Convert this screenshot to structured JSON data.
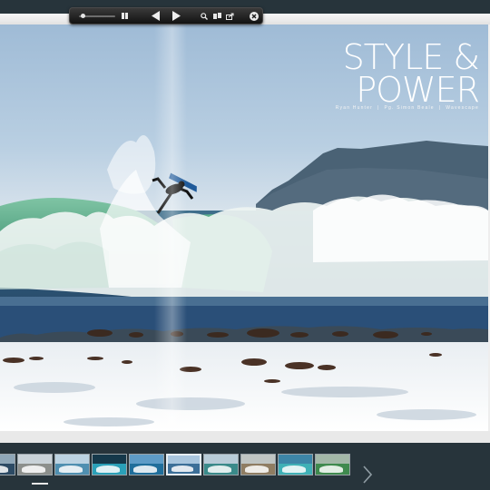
{
  "article": {
    "headline_line1": "STYLE &",
    "headline_line2": "POWER",
    "credit_rider": "Ryan Hunter",
    "credit_photo": "Pg. Simon Beale",
    "credit_publication": "Wavescape"
  },
  "toolbar": {
    "zoom_level": 0.05,
    "icons": [
      "zoom-slider",
      "view-mode-icon",
      "previous-page-icon",
      "next-page-icon",
      "search-icon",
      "pages-icon",
      "share-icon",
      "close-icon"
    ]
  },
  "thumbnails": {
    "active_index": 5,
    "items": [
      {
        "label": "thumb-1",
        "sky": "#8fa7b8",
        "sea": "#2c4a64"
      },
      {
        "label": "thumb-2",
        "sky": "#c9d2d8",
        "sea": "#8c8f8c"
      },
      {
        "label": "thumb-3",
        "sky": "#bcd3e2",
        "sea": "#4f8fb0"
      },
      {
        "label": "thumb-4",
        "sky": "#15384a",
        "sea": "#2aa0b8"
      },
      {
        "label": "thumb-5",
        "sky": "#5e9cc7",
        "sea": "#1f6e9b"
      },
      {
        "label": "thumb-6",
        "sky": "#a9c6de",
        "sea": "#3c6f98"
      },
      {
        "label": "thumb-7",
        "sky": "#b8ccd8",
        "sea": "#3a8a8a"
      },
      {
        "label": "thumb-8",
        "sky": "#bfc5c3",
        "sea": "#8f7d62"
      },
      {
        "label": "thumb-9",
        "sky": "#3d86a8",
        "sea": "#3fb0b6"
      },
      {
        "label": "thumb-10",
        "sky": "#a3b8a8",
        "sea": "#3f8a4e"
      }
    ]
  },
  "colors": {
    "chrome": "#27343b",
    "headline": "#ffffff",
    "wave_green": "#5fae8b",
    "sea_blue": "#274a6a"
  }
}
